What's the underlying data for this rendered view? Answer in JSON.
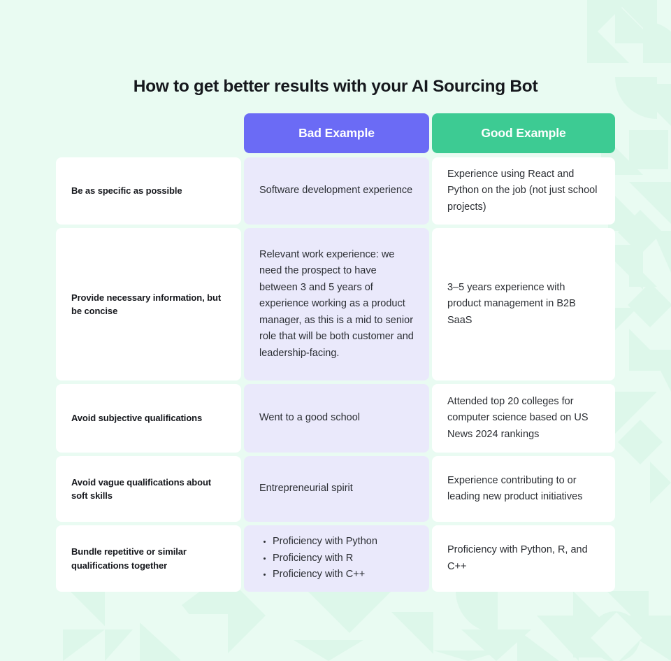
{
  "page": {
    "title": "How to get better results with your AI Sourcing Bot",
    "background_color": "#e9fbf2",
    "pattern_color": "#ddf7ea"
  },
  "table": {
    "headers": {
      "label_column": "",
      "bad_label": "Bad Example",
      "good_label": "Good Example",
      "bad_color": "#6b6bf5",
      "good_color": "#3dcb93"
    },
    "rows": [
      {
        "label": "Be as specific as possible",
        "bad": "Software development experience",
        "good": "Experience using React and Python on the job (not just school projects)"
      },
      {
        "label": "Provide necessary information, but be concise",
        "bad": "Relevant work experience: we need the prospect to have between 3 and 5 years of experience working as a product manager, as this is a mid to senior role that will be both customer and leadership-facing.",
        "good": "3–5 years experience with product management in B2B SaaS"
      },
      {
        "label": "Avoid subjective qualifications",
        "bad": "Went to a good school",
        "good": "Attended top 20 colleges for computer science based on US News 2024 rankings"
      },
      {
        "label": "Avoid vague qualifications about soft skills",
        "bad": "Entrepreneurial spirit",
        "good": "Experience contributing to or leading new product initiatives"
      },
      {
        "label": "Bundle repetitive or similar qualifications together",
        "bad_list": [
          "Proficiency with Python",
          "Proficiency with R",
          "Proficiency with C++"
        ],
        "good": "Proficiency with Python, R, and C++"
      }
    ]
  }
}
